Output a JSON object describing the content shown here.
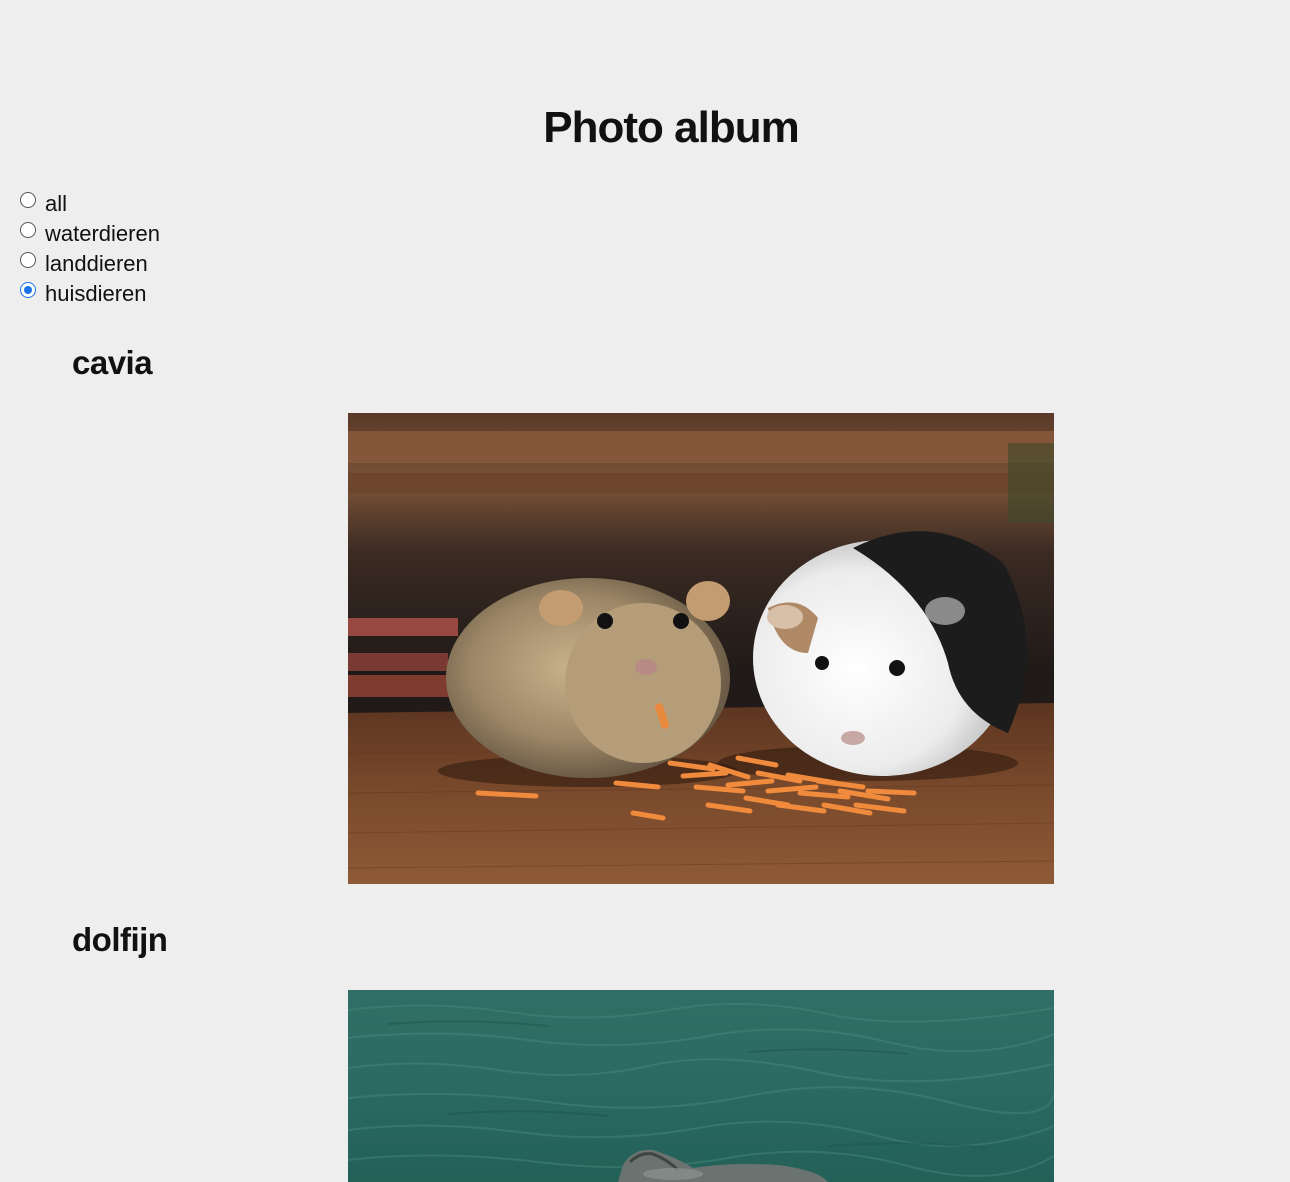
{
  "page": {
    "title": "Photo album"
  },
  "filters": {
    "options": [
      {
        "label": "all",
        "checked": false
      },
      {
        "label": "waterdieren",
        "checked": false
      },
      {
        "label": "landdieren",
        "checked": false
      },
      {
        "label": "huisdieren",
        "checked": true
      }
    ]
  },
  "album": {
    "items": [
      {
        "title": "cavia",
        "image": "guinea-pigs-eating-carrots-photo"
      },
      {
        "title": "dolfijn",
        "image": "dolphin-in-water-photo"
      }
    ]
  },
  "colors": {
    "background": "#eeeeee",
    "radio_accent": "#1a73e8"
  }
}
